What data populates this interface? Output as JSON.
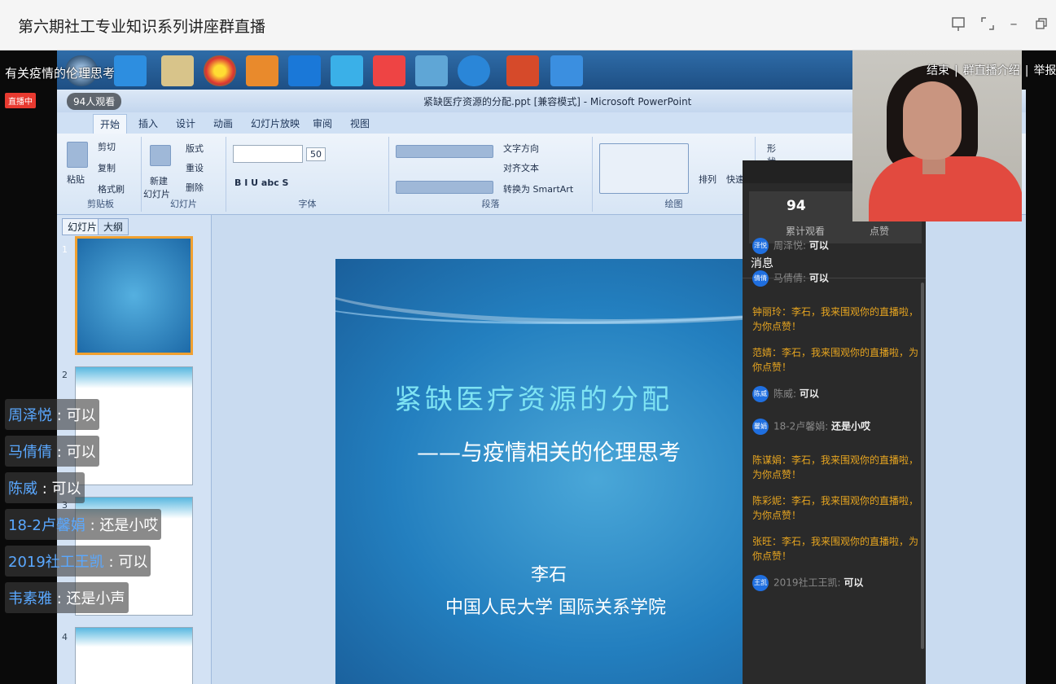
{
  "window": {
    "title": "第六期社工专业知识系列讲座群直播"
  },
  "live": {
    "title": "有关疫情的伦理思考",
    "badge": "直播中",
    "viewers": "94人观看",
    "links": [
      "结束",
      "群直播介绍",
      "举报"
    ]
  },
  "ppt": {
    "doc_title": "紧缺医疗资源的分配.ppt [兼容模式] - Microsoft PowerPoint",
    "tabs": [
      "开始",
      "插入",
      "设计",
      "动画",
      "幻灯片放映",
      "审阅",
      "视图"
    ],
    "groups": [
      "剪贴板",
      "幻灯片",
      "字体",
      "段落",
      "绘图"
    ],
    "clipboard": [
      "粘贴",
      "剪切",
      "复制",
      "格式刷"
    ],
    "slides_group": [
      "新建",
      "幻灯片",
      "版式",
      "重设",
      "删除"
    ],
    "paragraph_cmds": [
      "文字方向",
      "对齐文本",
      "转换为 SmartArt"
    ],
    "drawing_cmds": [
      "排列",
      "快速",
      "形状填充"
    ],
    "font_size": "50",
    "panel_tabs": [
      "幻灯片",
      "大纲"
    ],
    "slide": {
      "title": "紧缺医疗资源的分配",
      "subtitle": "——与疫情相关的伦理思考",
      "author": "李石",
      "org": "中国人民大学 国际关系学院"
    },
    "thumb_numbers": [
      "1",
      "2",
      "3",
      "4"
    ]
  },
  "panel": {
    "count": "94",
    "count_label": "累计观看",
    "like_label": "点赞",
    "messages_header": "消息",
    "messages": [
      {
        "type": "user",
        "avatar": "泽悦",
        "name": "周泽悦:",
        "text": "可以"
      },
      {
        "type": "user",
        "avatar": "倩倩",
        "name": "马倩倩:",
        "text": "可以"
      },
      {
        "type": "system",
        "text": "钟丽玲：李石，我来围观你的直播啦，为你点赞！"
      },
      {
        "type": "system",
        "text": "范婧：李石，我来围观你的直播啦，为你点赞！"
      },
      {
        "type": "user",
        "avatar": "陈威",
        "name": "陈威:",
        "text": "可以"
      },
      {
        "type": "user",
        "avatar": "馨娟",
        "name": "18-2卢馨娟:",
        "text": "还是小哎"
      },
      {
        "type": "system",
        "text": "陈谋娟：李石，我来围观你的直播啦，为你点赞！"
      },
      {
        "type": "system",
        "text": "陈彩妮：李石，我来围观你的直播啦，为你点赞！"
      },
      {
        "type": "system",
        "text": "张旺：李石，我来围观你的直播啦，为你点赞！"
      },
      {
        "type": "user",
        "avatar": "王凯",
        "name": "2019社工王凯:",
        "text": "可以"
      }
    ]
  },
  "danmaku": [
    {
      "user": "周泽悦",
      "text": "可以"
    },
    {
      "user": "马倩倩",
      "text": "可以"
    },
    {
      "user": "陈威",
      "text": "可以"
    },
    {
      "user": "18-2卢馨娟",
      "text": "还是小哎"
    },
    {
      "user": "2019社工王凯",
      "text": "可以"
    },
    {
      "user": "韦素雅",
      "text": "还是小声"
    }
  ]
}
